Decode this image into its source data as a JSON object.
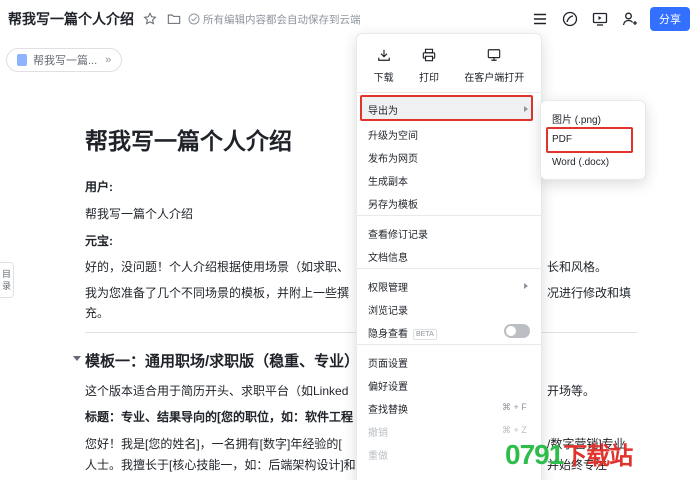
{
  "header": {
    "title": "帮我写一篇个人介绍",
    "save_status": "所有编辑内容都会自动保存到云端",
    "share_label": "分享"
  },
  "breadcrumb": {
    "label": "帮我写一篇..."
  },
  "toc_tab": {
    "line1": "目",
    "line2": "录"
  },
  "document": {
    "title": "帮我写一篇个人介绍",
    "user_label": "用户:",
    "user_text": "帮我写一篇个人介绍",
    "assistant_label": "元宝:",
    "para1_left": "好的，没问题！个人介绍根据使用场景（如求职、",
    "para1_right": "长和风格。",
    "para2_left": "我为您准备了几个不同场景的模板，并附上一些撰",
    "para2_right": "况进行修改和填",
    "para2_line2": "充。",
    "heading_template1": "模板一：通用职场/求职版（稳重、专业）",
    "para3_left": "这个版本适合用于简历开头、求职平台（如Linked",
    "para3_right": "开场等。",
    "para4_left": "标题：专业、结果导向的[您的职位，如：软件工程",
    "para5_left": "您好！我是[您的姓名]，一名拥有[数字]年经验的[",
    "para5_right": "/数字营销]专业",
    "para6_left": "人士。我擅长于[核心技能一，如：后端架构设计]和",
    "para6_right": "并始终专注"
  },
  "menu": {
    "top_actions": [
      {
        "label": "下载",
        "icon": "download-icon"
      },
      {
        "label": "打印",
        "icon": "printer-icon"
      },
      {
        "label": "在客户端打开",
        "icon": "monitor-icon"
      }
    ],
    "items": {
      "export": "导出为",
      "upgrade": "升级为空间",
      "publish": "发布为网页",
      "copy": "生成副本",
      "save_template": "另存为模板",
      "history": "查看修订记录",
      "doc_info": "文档信息",
      "permissions": "权限管理",
      "views": "浏览记录",
      "incognito": "隐身查看",
      "beta": "BETA",
      "page_settings": "页面设置",
      "preferences": "偏好设置",
      "find_replace": "查找替换",
      "find_replace_shortcut": "⌘ + F",
      "undo": "撤销",
      "undo_shortcut": "⌘ + Z",
      "redo": "重做"
    }
  },
  "submenu": {
    "png": "图片 (.png)",
    "pdf": "PDF",
    "docx": "Word (.docx)"
  },
  "watermark": {
    "digits": "0791",
    "text": "下载站"
  },
  "colors": {
    "accent": "#3370ff",
    "highlight": "#e0332d"
  }
}
